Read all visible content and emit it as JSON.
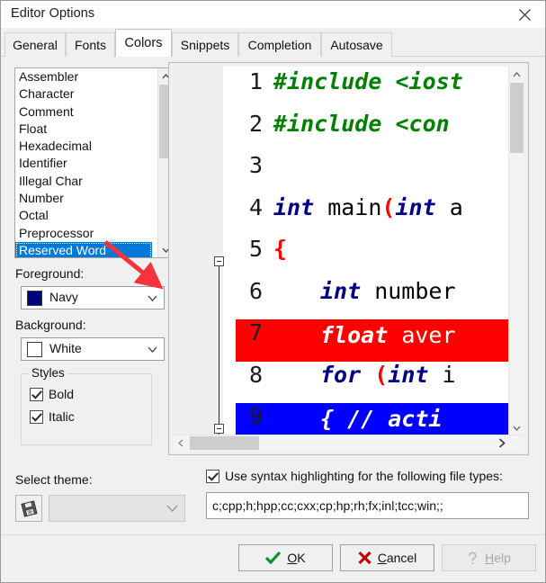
{
  "window": {
    "title": "Editor Options",
    "close_icon": "close-icon"
  },
  "tabs": [
    {
      "label": "General",
      "active": false
    },
    {
      "label": "Fonts",
      "active": false
    },
    {
      "label": "Colors",
      "active": true
    },
    {
      "label": "Snippets",
      "active": false
    },
    {
      "label": "Completion",
      "active": false
    },
    {
      "label": "Autosave",
      "active": false
    }
  ],
  "category_list": {
    "items": [
      "Assembler",
      "Character",
      "Comment",
      "Float",
      "Hexadecimal",
      "Identifier",
      "Illegal Char",
      "Number",
      "Octal",
      "Preprocessor",
      "Reserved Word"
    ],
    "selected": "Reserved Word",
    "scroll_up_icon": "chevron-up-icon",
    "scroll_down_icon": "chevron-down-icon"
  },
  "foreground": {
    "label": "Foreground:",
    "value": "Navy",
    "swatch_color": "#000080",
    "dropdown_icon": "chevron-down-icon"
  },
  "background": {
    "label": "Background:",
    "value": "White",
    "swatch_color": "#ffffff",
    "dropdown_icon": "chevron-down-icon"
  },
  "styles": {
    "title": "Styles",
    "options": [
      {
        "label": "Bold",
        "checked": true
      },
      {
        "label": "Italic",
        "checked": true
      }
    ]
  },
  "preview": {
    "lines": [
      {
        "num": "1",
        "highlight": "none",
        "tokens": [
          {
            "text": "#include <iost",
            "cls": "pp"
          }
        ]
      },
      {
        "num": "2",
        "highlight": "none",
        "tokens": [
          {
            "text": "#include <con",
            "cls": "pp"
          }
        ]
      },
      {
        "num": "3",
        "highlight": "none",
        "tokens": []
      },
      {
        "num": "4",
        "highlight": "none",
        "tokens": [
          {
            "text": "int",
            "cls": "k"
          },
          {
            "text": " main",
            "cls": "pl"
          },
          {
            "text": "(",
            "cls": "pn"
          },
          {
            "text": "int",
            "cls": "k"
          },
          {
            "text": " a",
            "cls": "pl"
          }
        ]
      },
      {
        "num": "5",
        "highlight": "none",
        "fold": true,
        "tokens": [
          {
            "text": "{",
            "cls": "pn"
          }
        ]
      },
      {
        "num": "6",
        "highlight": "none",
        "indent": true,
        "tokens": [
          {
            "text": "int",
            "cls": "k"
          },
          {
            "text": " number",
            "cls": "pl"
          }
        ]
      },
      {
        "num": "7",
        "highlight": "red",
        "indent": true,
        "tokens": [
          {
            "text": "float",
            "cls": "onred"
          },
          {
            "text": " aver",
            "cls": "onred-p"
          }
        ]
      },
      {
        "num": "8",
        "highlight": "none",
        "indent": true,
        "tokens": [
          {
            "text": "for",
            "cls": "k"
          },
          {
            "text": " ",
            "cls": "pl"
          },
          {
            "text": "(",
            "cls": "pn"
          },
          {
            "text": "int",
            "cls": "k"
          },
          {
            "text": " i",
            "cls": "pl"
          }
        ]
      },
      {
        "num": "9",
        "highlight": "blue",
        "indent": true,
        "fold": true,
        "tokens": [
          {
            "text": "{ // acti",
            "cls": "onblue"
          }
        ]
      }
    ],
    "vscroll": {
      "up_icon": "chevron-up-icon",
      "down_icon": "chevron-down-icon"
    },
    "hscroll": {
      "left_icon": "chevron-left-icon",
      "right_icon": "chevron-right-icon"
    }
  },
  "theme": {
    "label": "Select theme:",
    "value": "",
    "icon": "save-theme-icon",
    "dropdown_icon": "chevron-down-icon"
  },
  "syntax": {
    "checkbox_label": "Use syntax highlighting for the following file types:",
    "checked": true,
    "file_types": "c;cpp;h;hpp;cc;cxx;cp;hp;rh;fx;inl;tcc;win;;"
  },
  "buttons": {
    "ok": {
      "label_pre": "",
      "accel": "O",
      "label_post": "K",
      "icon": "check-icon",
      "enabled": true
    },
    "cancel": {
      "label_pre": "",
      "accel": "C",
      "label_post": "ancel",
      "icon": "cross-icon",
      "enabled": true
    },
    "help": {
      "label_pre": "",
      "accel": "H",
      "label_post": "elp",
      "icon": "question-icon",
      "enabled": false
    }
  },
  "annotation": {
    "type": "red-arrow",
    "color": "#f5333a",
    "from": "Reserved Word list item",
    "to": "int keyword on line 6"
  }
}
